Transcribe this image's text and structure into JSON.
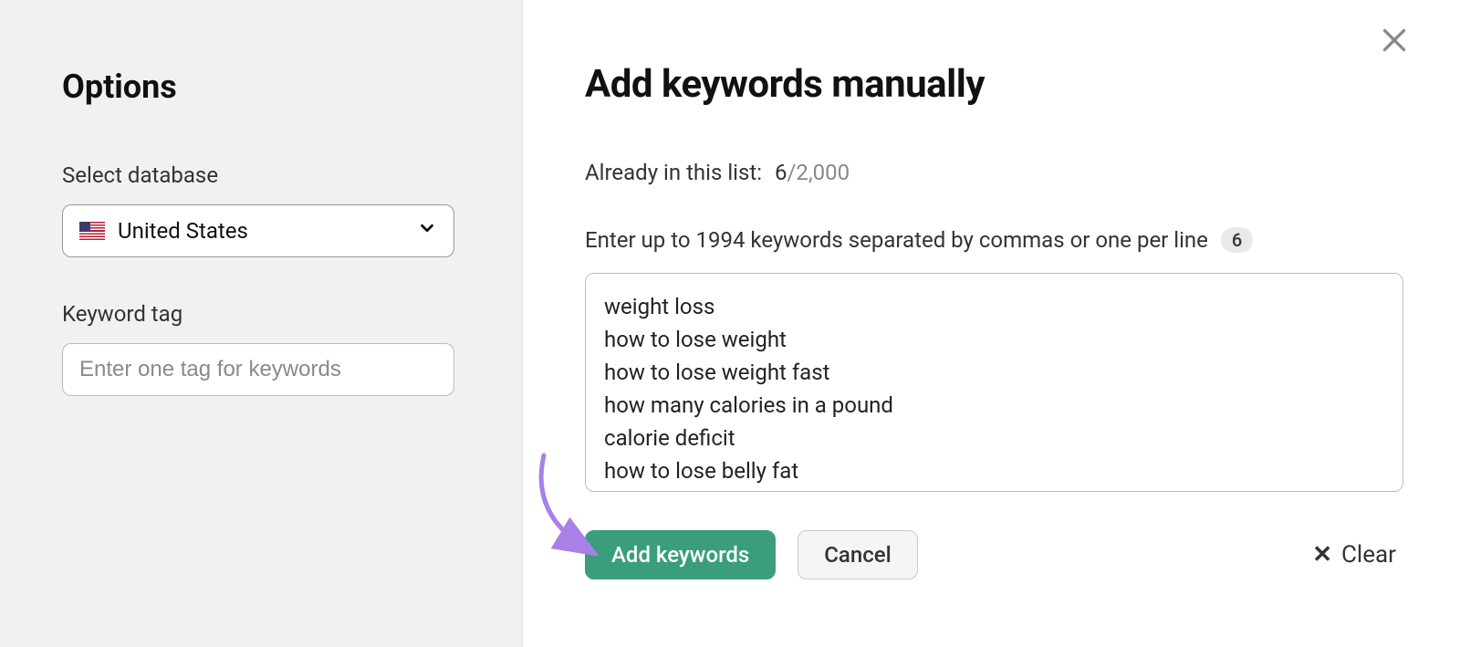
{
  "sidebar": {
    "title": "Options",
    "database_label": "Select database",
    "database_selected": "United States",
    "tag_label": "Keyword tag",
    "tag_placeholder": "Enter one tag for keywords"
  },
  "main": {
    "title": "Add keywords manually",
    "already_label": "Already in this list:",
    "already_count": "6",
    "already_max": "2,000",
    "instruction": "Enter up to 1994 keywords separated by commas or one per line",
    "badge_count": "6",
    "textarea_value": "weight loss\nhow to lose weight\nhow to lose weight fast\nhow many calories in a pound\ncalorie deficit\nhow to lose belly fat",
    "primary_button": "Add keywords",
    "secondary_button": "Cancel",
    "clear_action": "Clear"
  },
  "colors": {
    "accent": "#3a9e7a",
    "annotation": "#a97fe8"
  }
}
